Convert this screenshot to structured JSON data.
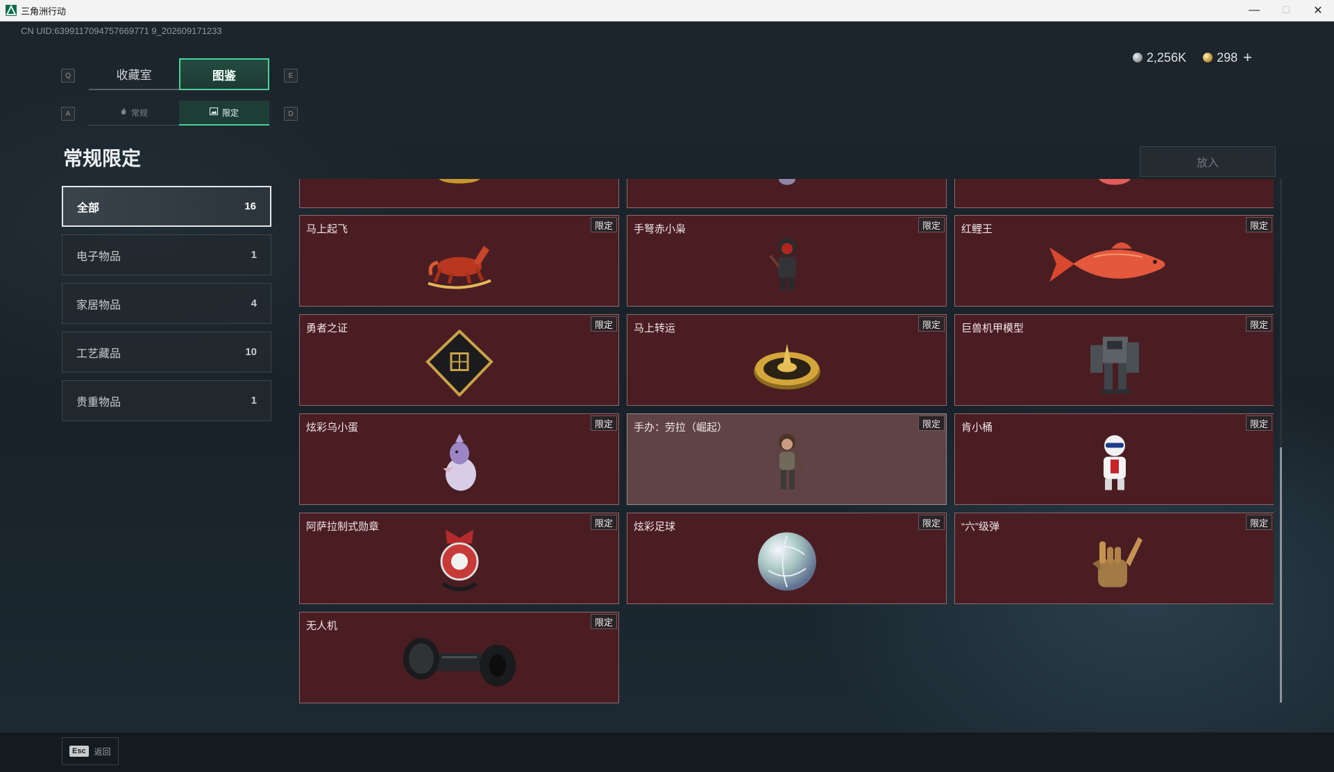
{
  "window": {
    "title": "三角洲行动"
  },
  "uid": "CN UID:6399117094757669771 9_202609171233",
  "currency": {
    "silver": "2,256K",
    "gold": "298",
    "plus": "+"
  },
  "keyhints": {
    "q": "Q",
    "e": "E",
    "a": "A",
    "d": "D"
  },
  "main_tabs": [
    {
      "label": "收藏室"
    },
    {
      "label": "图鉴"
    }
  ],
  "sub_tabs": [
    {
      "label": "常规"
    },
    {
      "label": "限定"
    }
  ],
  "section_title": "常规限定",
  "put_button": "放入",
  "categories": [
    {
      "label": "全部",
      "count": "16"
    },
    {
      "label": "电子物品",
      "count": "1"
    },
    {
      "label": "家居物品",
      "count": "4"
    },
    {
      "label": "工艺藏品",
      "count": "10"
    },
    {
      "label": "贵重物品",
      "count": "1"
    }
  ],
  "badge_label": "限定",
  "items": [
    {
      "name": ""
    },
    {
      "name": ""
    },
    {
      "name": ""
    },
    {
      "name": "马上起飞"
    },
    {
      "name": "手弩赤小枭"
    },
    {
      "name": "红鲤王"
    },
    {
      "name": "勇者之证"
    },
    {
      "name": "马上转运"
    },
    {
      "name": "巨兽机甲模型"
    },
    {
      "name": "炫彩乌小蛋"
    },
    {
      "name": "手办：劳拉（崛起）"
    },
    {
      "name": "肯小桶"
    },
    {
      "name": "阿萨拉制式勋章"
    },
    {
      "name": "炫彩足球"
    },
    {
      "name": "“六”级弹"
    },
    {
      "name": "无人机"
    }
  ],
  "footer": {
    "esc_key": "Esc",
    "back_label": "返回"
  },
  "colors": {
    "accent": "#48d49a",
    "card_bg": "#4a1d23",
    "card_border": "#8e6a6e"
  }
}
